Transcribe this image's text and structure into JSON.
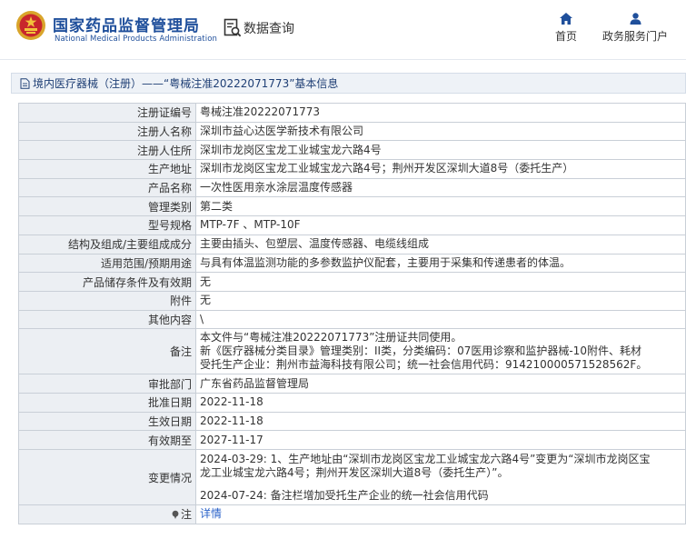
{
  "header": {
    "logo_cn": "国家药品监督管理局",
    "logo_en": "National Medical Products Administration",
    "logo_icon": "national-emblem-icon",
    "query_label": "数据查询",
    "query_icon": "document-search-icon",
    "nav": [
      {
        "label": "首页",
        "icon": "home-icon"
      },
      {
        "label": "政务服务门户",
        "icon": "user-icon"
      }
    ]
  },
  "breadcrumb": {
    "icon": "document-icon",
    "text": "境内医疗器械（注册）——“粤械注准20222071773”基本信息"
  },
  "rows": [
    {
      "label": "注册证编号",
      "value": "粤械注准20222071773"
    },
    {
      "label": "注册人名称",
      "value": "深圳市益心达医学新技术有限公司"
    },
    {
      "label": "注册人住所",
      "value": "深圳市龙岗区宝龙工业城宝龙六路4号"
    },
    {
      "label": "生产地址",
      "value": "深圳市龙岗区宝龙工业城宝龙六路4号；荆州开发区深圳大道8号（委托生产）"
    },
    {
      "label": "产品名称",
      "value": "一次性医用亲水涂层温度传感器"
    },
    {
      "label": "管理类别",
      "value": "第二类"
    },
    {
      "label": "型号规格",
      "value": "MTP-7F 、MTP-10F"
    },
    {
      "label": "结构及组成/主要组成成分",
      "value": "主要由插头、包塑层、温度传感器、电缆线组成"
    },
    {
      "label": "适用范围/预期用途",
      "value": "与具有体温监测功能的多参数监护仪配套，主要用于采集和传递患者的体温。"
    },
    {
      "label": "产品储存条件及有效期",
      "value": "无"
    },
    {
      "label": "附件",
      "value": "无"
    },
    {
      "label": "其他内容",
      "value": "\\"
    }
  ],
  "remark": {
    "label": "备注",
    "lines": [
      "本文件与“粤械注准20222071773”注册证共同使用。",
      "新《医疗器械分类目录》管理类别：II类，分类编码：07医用诊察和监护器械-10附件、耗材",
      "受托生产企业：荆州市益海科技有限公司；统一社会信用代码：91421000057152856​2F。"
    ]
  },
  "rows2": [
    {
      "label": "审批部门",
      "value": "广东省药品监督管理局"
    },
    {
      "label": "批准日期",
      "value": "2022-11-18"
    },
    {
      "label": "生效日期",
      "value": "2022-11-18"
    },
    {
      "label": "有效期至",
      "value": "2027-11-17"
    }
  ],
  "changes": {
    "label": "变更情况",
    "entry1_line1": "2024-03-29: 1、生产地址由“深圳市龙岗区宝龙工业城宝龙六路4号”变更为“深圳市龙岗区宝",
    "entry1_line2": "龙工业城宝龙六路4号；荆州开发区深圳大道8号（委托生产）”。",
    "entry2": "2024-07-24: 备注栏增加受托生产企业的统一社会信用代码"
  },
  "note": {
    "label": "注",
    "icon": "pin-icon",
    "link": "详情"
  },
  "colors": {
    "brand_blue": "#1f4f9b",
    "label_bg": "#eceff3",
    "border": "#c9cfd7",
    "link": "#2a62c9"
  }
}
